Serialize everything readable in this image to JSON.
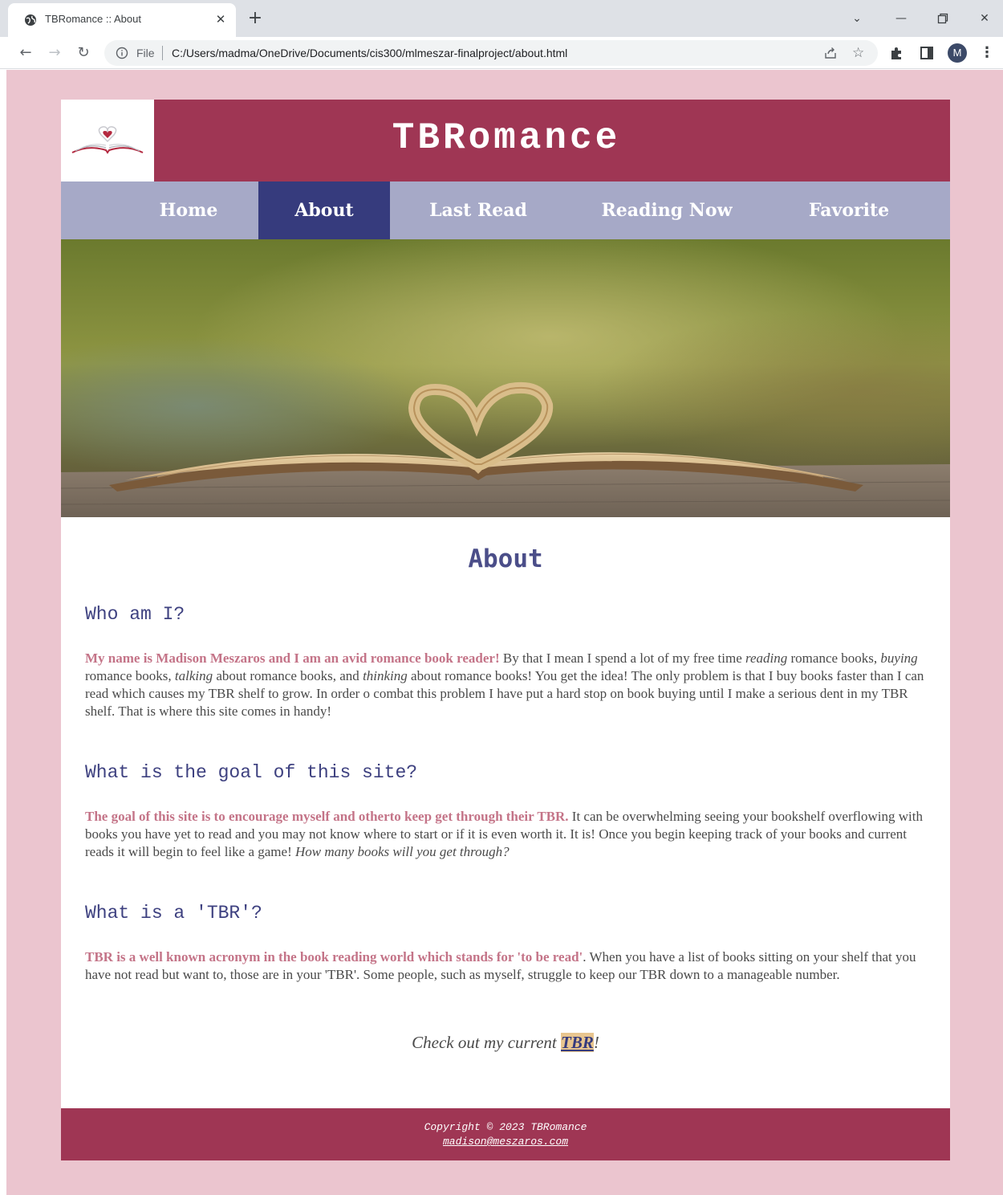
{
  "browser": {
    "tab_title": "TBRomance :: About",
    "url_scheme": "File",
    "url": "C:/Users/madma/OneDrive/Documents/cis300/mlmeszar-finalproject/about.html",
    "profile_initial": "M"
  },
  "site": {
    "title": "TBRomance",
    "nav": [
      {
        "label": "Home"
      },
      {
        "label": "About"
      },
      {
        "label": "Last Read"
      },
      {
        "label": "Reading Now"
      },
      {
        "label": "Favorite"
      }
    ],
    "active_nav": "About"
  },
  "content": {
    "heading": "About",
    "sections": [
      {
        "title": "Who am I?",
        "lead": "My name is Madison Meszaros and I am an avid romance book reader!",
        "body_html": " By that I mean I spend a lot of my free time <i>reading</i> romance books, <i>buying</i> romance books, <i>talking</i> about romance books, and <i>thinking</i> about romance books! You get the idea! The only problem is that I buy books faster than I can read which causes my TBR shelf to grow. In order o combat this problem I have put a hard stop on book buying until I make a serious dent in my TBR shelf. That is where this site comes in handy!"
      },
      {
        "title": "What is the goal of this site?",
        "lead": "The goal of this site is to encourage myself and otherto keep get through their TBR.",
        "body_html": " It can be overwhelming seeing your bookshelf overflowing with books you have yet to read and you may not know where to start or if it is even worth it. It is! Once you begin keeping track of your books and current reads it will begin to feel like a game! <i>How many books will you get through?</i>"
      },
      {
        "title": "What is a 'TBR'?",
        "lead": "TBR is a well known acronym in the book reading world which stands for 'to be read'",
        "body_html": ". When you have a list of books sitting on your shelf that you have not read but want to, those are in your 'TBR'. Some people, such as myself, struggle to keep our TBR down to a manageable number."
      }
    ],
    "cta_prefix": "Check out my current ",
    "cta_link": "TBR",
    "cta_suffix": "!"
  },
  "footer": {
    "copyright": "Copyright © 2023 TBRomance",
    "email": "madison@meszaros.com"
  },
  "colors": {
    "page_bg": "#ebc5cf",
    "header_bg": "#9f3654",
    "nav_bg": "#a6a9c7",
    "nav_active_bg": "#363b7d",
    "heading_color": "#4b4e89",
    "lead_color": "#c47488",
    "link_highlight": "#e8c58f"
  }
}
